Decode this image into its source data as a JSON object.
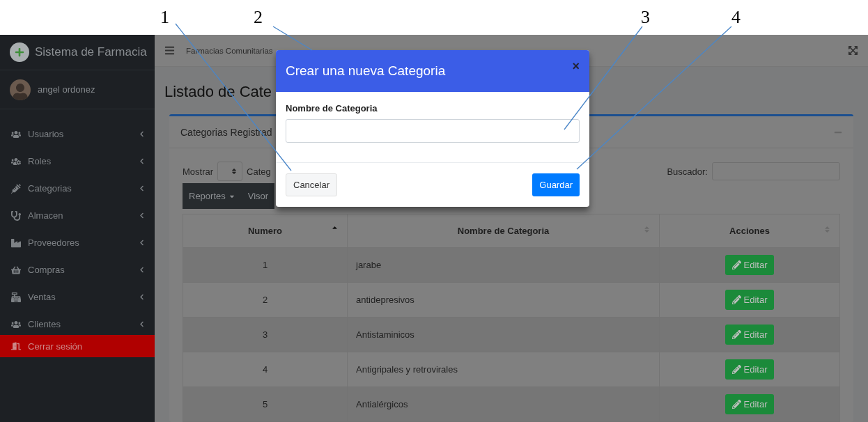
{
  "annotations": [
    {
      "label": "1"
    },
    {
      "label": "2"
    },
    {
      "label": "3"
    },
    {
      "label": "4"
    }
  ],
  "sidebar": {
    "brand": "Sistema de Farmacia",
    "user": "angel ordonez",
    "items": [
      {
        "label": "Usuarios"
      },
      {
        "label": "Roles"
      },
      {
        "label": "Categorias"
      },
      {
        "label": "Almacen"
      },
      {
        "label": "Proveedores"
      },
      {
        "label": "Compras"
      },
      {
        "label": "Ventas"
      },
      {
        "label": "Clientes"
      }
    ],
    "logout": "Cerrar sesión"
  },
  "navbar": {
    "title": "Farmacias Comunitarias"
  },
  "page": {
    "heading": "Listado de Cate"
  },
  "card": {
    "title": "Categorias Registrad",
    "show_label": "Mostrar",
    "show_suffix": "Categ",
    "search_label": "Buscador:",
    "buttons": [
      "Reportes",
      "Visor"
    ],
    "columns": [
      {
        "label": "Numero",
        "sorted": true
      },
      {
        "label": "Nombre de Categoria",
        "sorted": false
      },
      {
        "label": "Acciones",
        "sorted": false
      }
    ],
    "rows": [
      {
        "number": "1",
        "name": "jarabe",
        "action": "Editar"
      },
      {
        "number": "2",
        "name": "antidepresivos",
        "action": "Editar"
      },
      {
        "number": "3",
        "name": "Antistaminicos",
        "action": "Editar"
      },
      {
        "number": "4",
        "name": "Antigripales y retrovirales",
        "action": "Editar"
      },
      {
        "number": "5",
        "name": "Antialérgicos",
        "action": "Editar"
      }
    ]
  },
  "modal": {
    "title": "Crear una nueva Categoria",
    "close": "×",
    "field_label": "Nombre de Categoria",
    "cancel": "Cancelar",
    "save": "Guardar"
  }
}
